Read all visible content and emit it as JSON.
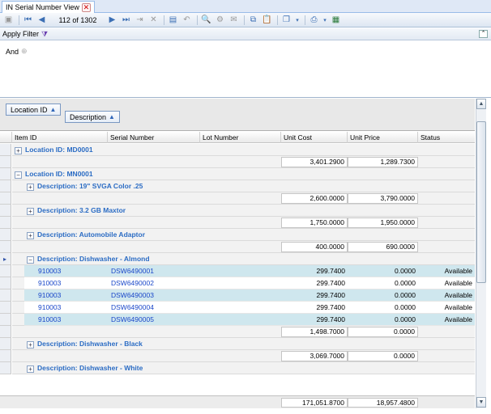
{
  "tab": {
    "title": "IN Serial Number View"
  },
  "toolbar": {
    "record_text": "112 of 1302",
    "icons": [
      "save-icon",
      "first-icon",
      "prev-icon",
      "next-icon",
      "last-icon",
      "append-icon",
      "delete-icon",
      "edit-icon",
      "undo-icon",
      "preview-icon",
      "approve-icon",
      "copy-icon",
      "paste-icon",
      "clone-icon",
      "print-icon",
      "export-icon",
      "excel-icon"
    ]
  },
  "filter": {
    "title": "Apply Filter",
    "and_label": "And"
  },
  "group_panel": {
    "chips": [
      {
        "label": "Location ID"
      },
      {
        "label": "Description"
      }
    ]
  },
  "columns": [
    "Item ID",
    "Serial Number",
    "Lot Number",
    "Unit Cost",
    "Unit Price",
    "Status"
  ],
  "rows": [
    {
      "kind": "group",
      "level": 1,
      "label": "Location ID: MD0001",
      "expanded": false
    },
    {
      "kind": "summary",
      "level": 1,
      "cost": "3,401.2900",
      "price": "1,289.7300"
    },
    {
      "kind": "group",
      "level": 1,
      "label": "Location ID: MN0001",
      "expanded": true
    },
    {
      "kind": "group",
      "level": 2,
      "label": "Description: 19\" SVGA Color .25",
      "expanded": false
    },
    {
      "kind": "summary",
      "level": 2,
      "cost": "2,600.0000",
      "price": "3,790.0000"
    },
    {
      "kind": "group",
      "level": 2,
      "label": "Description: 3.2 GB Maxtor",
      "expanded": false
    },
    {
      "kind": "summary",
      "level": 2,
      "cost": "1,750.0000",
      "price": "1,950.0000"
    },
    {
      "kind": "group",
      "level": 2,
      "label": "Description: Automobile Adaptor",
      "expanded": false
    },
    {
      "kind": "summary",
      "level": 2,
      "cost": "400.0000",
      "price": "690.0000"
    },
    {
      "kind": "group",
      "level": 2,
      "label": "Description: Dishwasher - Almond",
      "expanded": true,
      "current": true
    },
    {
      "kind": "data",
      "item": "910003",
      "serial": "DSW6490001",
      "lot": "",
      "cost": "299.7400",
      "price": "0.0000",
      "status": "Available",
      "alt": true
    },
    {
      "kind": "data",
      "item": "910003",
      "serial": "DSW6490002",
      "lot": "",
      "cost": "299.7400",
      "price": "0.0000",
      "status": "Available",
      "alt": false
    },
    {
      "kind": "data",
      "item": "910003",
      "serial": "DSW6490003",
      "lot": "",
      "cost": "299.7400",
      "price": "0.0000",
      "status": "Available",
      "alt": true
    },
    {
      "kind": "data",
      "item": "910003",
      "serial": "DSW6490004",
      "lot": "",
      "cost": "299.7400",
      "price": "0.0000",
      "status": "Available",
      "alt": false
    },
    {
      "kind": "data",
      "item": "910003",
      "serial": "DSW6490005",
      "lot": "",
      "cost": "299.7400",
      "price": "0.0000",
      "status": "Available",
      "alt": true
    },
    {
      "kind": "summary",
      "level": 2,
      "cost": "1,498.7000",
      "price": "0.0000"
    },
    {
      "kind": "group",
      "level": 2,
      "label": "Description: Dishwasher - Black",
      "expanded": false
    },
    {
      "kind": "summary",
      "level": 2,
      "cost": "3,069.7000",
      "price": "0.0000"
    },
    {
      "kind": "group",
      "level": 2,
      "label": "Description: Dishwasher - White",
      "expanded": false
    }
  ],
  "footer": {
    "cost": "171,051.8700",
    "price": "18,957.4800"
  },
  "colors": {
    "group_text": "#2b6cc4",
    "link_text": "#1a47c9",
    "alt_row": "#cfe7ee",
    "header_bg": "#dfe8f6"
  }
}
